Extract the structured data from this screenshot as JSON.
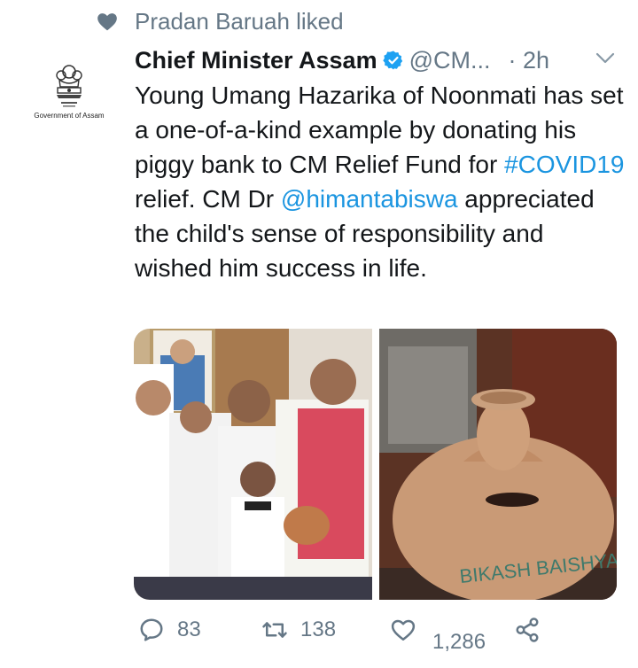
{
  "social_context": {
    "icon": "heart-icon",
    "text": "Pradan Baruah liked"
  },
  "avatar": {
    "icon": "emblem-icon",
    "caption": "Government of Assam"
  },
  "tweet": {
    "display_name": "Chief Minister Assam",
    "verified": true,
    "handle": "@CM...",
    "time": "· 2h",
    "text_segments": [
      {
        "text": "Young Umang Hazarika of Noonmati has set a one-of-a-kind example by donating his piggy bank to CM Relief Fund for ",
        "link": false
      },
      {
        "text": "#COVID19",
        "link": true
      },
      {
        "text": " relief. CM Dr ",
        "link": false
      },
      {
        "text": "@himantabiswa",
        "link": true
      },
      {
        "text": " appreciated the child's sense of responsibility and wished him success in life.",
        "link": false
      }
    ],
    "media": [
      {
        "name": "photo-cm-with-child",
        "description_visible_text": ""
      },
      {
        "name": "photo-piggy-bank",
        "visible_text": "BIKASH BAISHYA"
      }
    ]
  },
  "actions": {
    "reply": {
      "icon": "reply-icon",
      "count": "83"
    },
    "retweet": {
      "icon": "retweet-icon",
      "count": "138"
    },
    "like": {
      "icon": "heart-outline-icon",
      "count": "1,286"
    },
    "share": {
      "icon": "share-icon",
      "count": ""
    }
  },
  "colors": {
    "link": "#1b95e0",
    "secondary_text": "#657786",
    "primary_text": "#14171a",
    "verified": "#1da1f2"
  }
}
